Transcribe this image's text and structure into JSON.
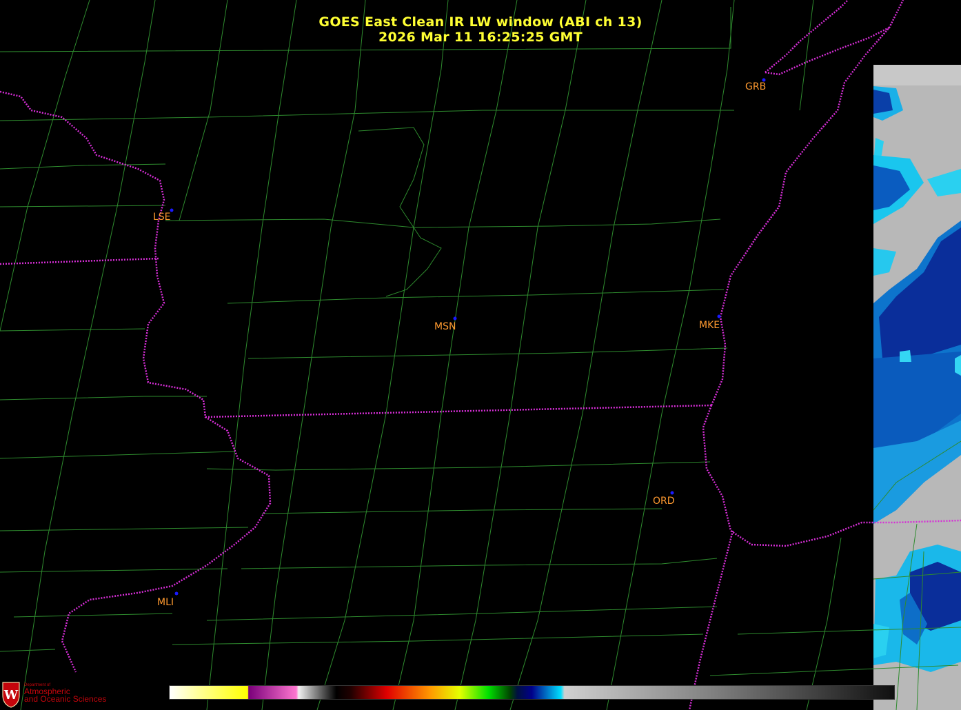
{
  "title": {
    "line1": "GOES East Clean IR LW window (ABI ch 13)",
    "line2": "2026 Mar 11  16:25:25 GMT"
  },
  "colors": {
    "title": "#ffff33",
    "city_label": "#ff9a30",
    "city_marker": "#1a1aff",
    "county_lines": "#2e8b2e",
    "state_borders": "#d62ed6",
    "background": "#000000"
  },
  "cities": [
    {
      "id": "GRB",
      "label": "GRB"
    },
    {
      "id": "LSE",
      "label": "LSE"
    },
    {
      "id": "MSN",
      "label": "MSN"
    },
    {
      "id": "MKE",
      "label": "MKE"
    },
    {
      "id": "ORD",
      "label": "ORD"
    },
    {
      "id": "MLI",
      "label": "MLI"
    }
  ],
  "colorbar": {
    "description_colors": [
      "#ffffff",
      "#ffff00",
      "#800080",
      "#ff66cc",
      "#000000",
      "#ff0000",
      "#ffaa00",
      "#00ff00",
      "#000080",
      "#00ddff",
      "#c0c0c0",
      "#101010"
    ]
  },
  "logo": {
    "line1": "Department of",
    "line2": "Atmospheric",
    "line3": "and Oceanic Sciences",
    "emblem_letter": "W"
  }
}
